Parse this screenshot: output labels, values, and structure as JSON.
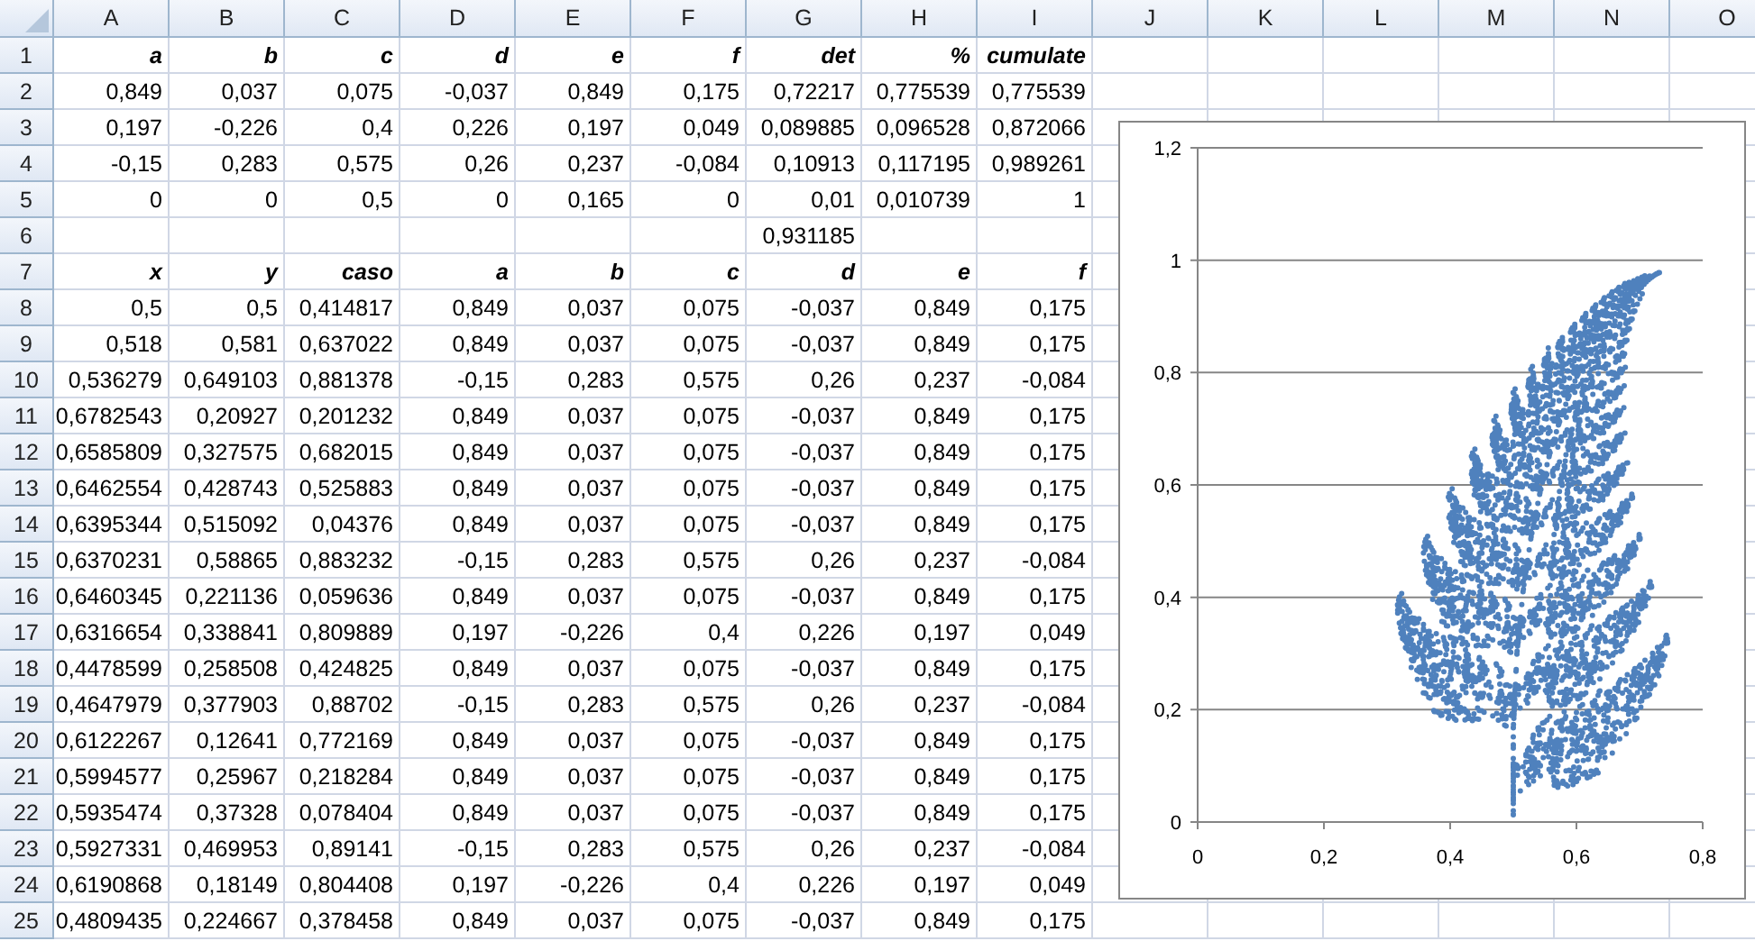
{
  "table": {
    "columns": [
      "A",
      "B",
      "C",
      "D",
      "E",
      "F",
      "G",
      "H",
      "I",
      "J",
      "K",
      "L",
      "M",
      "N",
      "O"
    ],
    "rows": [
      {
        "number": "1",
        "kind": "header",
        "cells": [
          "a",
          "b",
          "c",
          "d",
          "e",
          "f",
          "det",
          "%",
          "cumulate"
        ]
      },
      {
        "number": "2",
        "kind": "data",
        "cells": [
          "0,849",
          "0,037",
          "0,075",
          "-0,037",
          "0,849",
          "0,175",
          "0,72217",
          "0,775539",
          "0,775539"
        ]
      },
      {
        "number": "3",
        "kind": "data",
        "cells": [
          "0,197",
          "-0,226",
          "0,4",
          "0,226",
          "0,197",
          "0,049",
          "0,089885",
          "0,096528",
          "0,872066"
        ]
      },
      {
        "number": "4",
        "kind": "data",
        "cells": [
          "-0,15",
          "0,283",
          "0,575",
          "0,26",
          "0,237",
          "-0,084",
          "0,10913",
          "0,117195",
          "0,989261"
        ]
      },
      {
        "number": "5",
        "kind": "data",
        "cells": [
          "0",
          "0",
          "0,5",
          "0",
          "0,165",
          "0",
          "0,01",
          "0,010739",
          "1"
        ]
      },
      {
        "number": "6",
        "kind": "data",
        "cells": [
          null,
          null,
          null,
          null,
          null,
          null,
          "0,931185",
          null,
          null
        ]
      },
      {
        "number": "7",
        "kind": "header",
        "cells": [
          "x",
          "y",
          "caso",
          "a",
          "b",
          "c",
          "d",
          "e",
          "f"
        ]
      },
      {
        "number": "8",
        "kind": "data",
        "cells": [
          "0,5",
          "0,5",
          "0,414817",
          "0,849",
          "0,037",
          "0,075",
          "-0,037",
          "0,849",
          "0,175"
        ]
      },
      {
        "number": "9",
        "kind": "data",
        "cells": [
          "0,518",
          "0,581",
          "0,637022",
          "0,849",
          "0,037",
          "0,075",
          "-0,037",
          "0,849",
          "0,175"
        ]
      },
      {
        "number": "10",
        "kind": "data",
        "cells": [
          "0,536279",
          "0,649103",
          "0,881378",
          "-0,15",
          "0,283",
          "0,575",
          "0,26",
          "0,237",
          "-0,084"
        ]
      },
      {
        "number": "11",
        "kind": "data",
        "cells": [
          "0,6782543",
          "0,20927",
          "0,201232",
          "0,849",
          "0,037",
          "0,075",
          "-0,037",
          "0,849",
          "0,175"
        ]
      },
      {
        "number": "12",
        "kind": "data",
        "cells": [
          "0,6585809",
          "0,327575",
          "0,682015",
          "0,849",
          "0,037",
          "0,075",
          "-0,037",
          "0,849",
          "0,175"
        ]
      },
      {
        "number": "13",
        "kind": "data",
        "cells": [
          "0,6462554",
          "0,428743",
          "0,525883",
          "0,849",
          "0,037",
          "0,075",
          "-0,037",
          "0,849",
          "0,175"
        ]
      },
      {
        "number": "14",
        "kind": "data",
        "cells": [
          "0,6395344",
          "0,515092",
          "0,04376",
          "0,849",
          "0,037",
          "0,075",
          "-0,037",
          "0,849",
          "0,175"
        ]
      },
      {
        "number": "15",
        "kind": "data",
        "cells": [
          "0,6370231",
          "0,58865",
          "0,883232",
          "-0,15",
          "0,283",
          "0,575",
          "0,26",
          "0,237",
          "-0,084"
        ]
      },
      {
        "number": "16",
        "kind": "data",
        "cells": [
          "0,6460345",
          "0,221136",
          "0,059636",
          "0,849",
          "0,037",
          "0,075",
          "-0,037",
          "0,849",
          "0,175"
        ]
      },
      {
        "number": "17",
        "kind": "data",
        "cells": [
          "0,6316654",
          "0,338841",
          "0,809889",
          "0,197",
          "-0,226",
          "0,4",
          "0,226",
          "0,197",
          "0,049"
        ]
      },
      {
        "number": "18",
        "kind": "data",
        "cells": [
          "0,4478599",
          "0,258508",
          "0,424825",
          "0,849",
          "0,037",
          "0,075",
          "-0,037",
          "0,849",
          "0,175"
        ]
      },
      {
        "number": "19",
        "kind": "data",
        "cells": [
          "0,4647979",
          "0,377903",
          "0,88702",
          "-0,15",
          "0,283",
          "0,575",
          "0,26",
          "0,237",
          "-0,084"
        ]
      },
      {
        "number": "20",
        "kind": "data",
        "cells": [
          "0,6122267",
          "0,12641",
          "0,772169",
          "0,849",
          "0,037",
          "0,075",
          "-0,037",
          "0,849",
          "0,175"
        ]
      },
      {
        "number": "21",
        "kind": "data",
        "cells": [
          "0,5994577",
          "0,25967",
          "0,218284",
          "0,849",
          "0,037",
          "0,075",
          "-0,037",
          "0,849",
          "0,175"
        ]
      },
      {
        "number": "22",
        "kind": "data",
        "cells": [
          "0,5935474",
          "0,37328",
          "0,078404",
          "0,849",
          "0,037",
          "0,075",
          "-0,037",
          "0,849",
          "0,175"
        ]
      },
      {
        "number": "23",
        "kind": "data",
        "cells": [
          "0,5927331",
          "0,469953",
          "0,89141",
          "-0,15",
          "0,283",
          "0,575",
          "0,26",
          "0,237",
          "-0,084"
        ]
      },
      {
        "number": "24",
        "kind": "data",
        "cells": [
          "0,6190868",
          "0,18149",
          "0,804408",
          "0,197",
          "-0,226",
          "0,4",
          "0,226",
          "0,197",
          "0,049"
        ]
      },
      {
        "number": "25",
        "kind": "data",
        "cells": [
          "0,4809435",
          "0,224667",
          "0,378458",
          "0,849",
          "0,037",
          "0,075",
          "-0,037",
          "0,849",
          "0,175"
        ]
      }
    ]
  },
  "chart": {
    "chart_data": {
      "type": "scatter",
      "grid": true,
      "xlim": [
        0,
        0.8
      ],
      "ylim": [
        0,
        1.2
      ],
      "xticks": [
        {
          "value": 0,
          "label": "0"
        },
        {
          "value": 0.2,
          "label": "0,2"
        },
        {
          "value": 0.4,
          "label": "0,4"
        },
        {
          "value": 0.6,
          "label": "0,6"
        },
        {
          "value": 0.8,
          "label": "0,8"
        }
      ],
      "yticks": [
        {
          "value": 0,
          "label": "0"
        },
        {
          "value": 0.2,
          "label": "0,2"
        },
        {
          "value": 0.4,
          "label": "0,4"
        },
        {
          "value": 0.6,
          "label": "0,6"
        },
        {
          "value": 0.8,
          "label": "0,8"
        },
        {
          "value": 1,
          "label": "1"
        },
        {
          "value": 1.2,
          "label": "1,2"
        }
      ]
    }
  }
}
